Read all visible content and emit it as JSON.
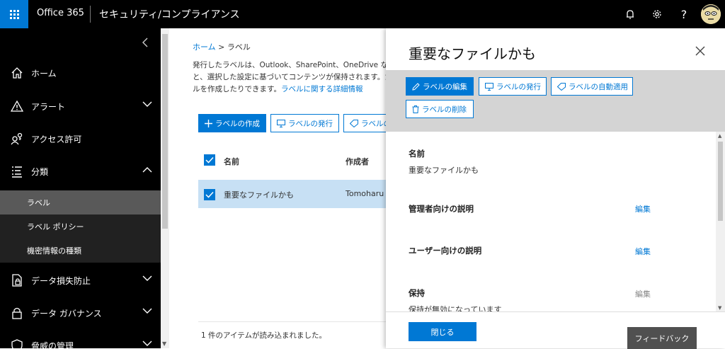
{
  "header": {
    "brand": "Office 365",
    "app_title": "セキュリティ/コンプライアンス"
  },
  "nav": {
    "items": [
      {
        "label": "ホーム",
        "icon": "home-icon"
      },
      {
        "label": "アラート",
        "icon": "alert-icon"
      },
      {
        "label": "アクセス許可",
        "icon": "permissions-icon"
      },
      {
        "label": "分類",
        "icon": "classification-icon"
      },
      {
        "label": "データ損失防止",
        "icon": "data-loss-prevention-icon"
      },
      {
        "label": "データ ガバナンス",
        "icon": "data-governance-icon"
      },
      {
        "label": "脅威の管理",
        "icon": "threat-management-icon"
      }
    ],
    "subitems": [
      {
        "label": "ラベル",
        "selected": true
      },
      {
        "label": "ラベル ポリシー",
        "selected": false
      },
      {
        "label": "機密情報の種類",
        "selected": false
      }
    ]
  },
  "main": {
    "breadcrumb": {
      "home": "ホーム",
      "current": "ラベル"
    },
    "description": {
      "line1": "発行したラベルは、Outlook、SharePoint、OneDrive など(",
      "line2": "と、選択した設定に基づいてコンテンツが保持されます。たとえば",
      "line3": "ルを作成したりできます。",
      "link": "ラベルに関する詳細情報"
    },
    "toolbar": {
      "create": "ラベルの作成",
      "publish": "ラベルの発行",
      "auto_apply": "ラベルの自"
    },
    "table": {
      "columns": [
        "名前",
        "作成者"
      ],
      "rows": [
        {
          "name": "重要なファイルかも",
          "author": "Tomoharu"
        }
      ]
    },
    "status": "1 件のアイテムが読み込まれました。"
  },
  "panel": {
    "title": "重要なファイルかも",
    "toolbar": {
      "edit": "ラベルの編集",
      "publish": "ラベルの発行",
      "auto_apply": "ラベルの自動適用",
      "delete": "ラベルの削除"
    },
    "sections": {
      "name_label": "名前",
      "name_value": "重要なファイルかも",
      "admin_desc_label": "管理者向けの説明",
      "user_desc_label": "ユーザー向けの説明",
      "retention_label": "保持",
      "retention_value": "保持が無効になっています",
      "edit": "編集"
    },
    "close_button": "閉じる",
    "feedback_button": "フィードバック"
  },
  "colors": {
    "accent": "#0078d4",
    "topbar": "#000000",
    "nav": "#000000",
    "selected_row": "#c7e0f4",
    "panel_toolbar": "#d4d4d4"
  }
}
